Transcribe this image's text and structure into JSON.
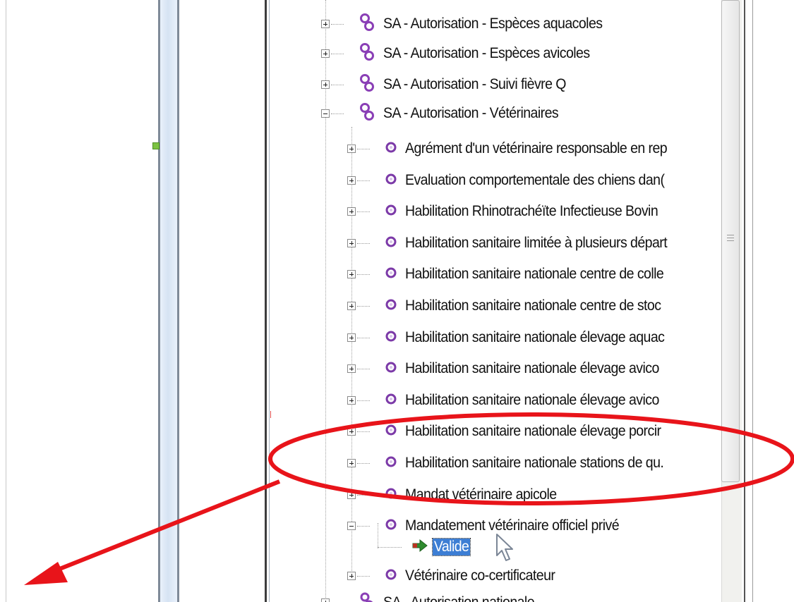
{
  "tree": {
    "groups": [
      {
        "label": "SA - Autorisation - Espèces aquacoles",
        "expanded": false
      },
      {
        "label": "SA - Autorisation - Espèces avicoles",
        "expanded": false
      },
      {
        "label": "SA - Autorisation - Suivi fièvre Q",
        "expanded": false
      },
      {
        "label": "SA - Autorisation - Vétérinaires",
        "expanded": true
      }
    ],
    "children": [
      {
        "label": "Agrément d'un vétérinaire responsable en rep"
      },
      {
        "label": "Evaluation comportementale des chiens dan("
      },
      {
        "label": "Habilitation Rhinotrachéïte Infectieuse Bovin"
      },
      {
        "label": "Habilitation sanitaire limitée à plusieurs départ"
      },
      {
        "label": "Habilitation sanitaire nationale centre de colle"
      },
      {
        "label": "Habilitation sanitaire nationale centre de stoc"
      },
      {
        "label": "Habilitation sanitaire nationale élevage aquac"
      },
      {
        "label": "Habilitation sanitaire nationale élevage avico"
      },
      {
        "label": "Habilitation sanitaire nationale élevage avico"
      },
      {
        "label": "Habilitation sanitaire nationale élevage porcir"
      },
      {
        "label": "Habilitation sanitaire nationale stations de qu."
      },
      {
        "label": "Mandat vétérinaire apicole"
      },
      {
        "label": "Mandatement vétérinaire officiel privé"
      }
    ],
    "state_item": {
      "label": "Valide",
      "selected": true
    },
    "after_children": [
      {
        "label": "Vétérinaire co-certificateur"
      }
    ],
    "last_group": {
      "label": "SA - Autorisation nationale"
    }
  },
  "colors": {
    "annotation": "#e8141a",
    "selection": "#3d7ed4",
    "group_icon": "#8a3fb6",
    "leaf_icon": "#7c3aa8",
    "state_arrow": "#2e8b2e"
  },
  "icons": {
    "group": "linked-circles-icon",
    "leaf": "ring-icon",
    "state": "green-arrow-icon",
    "cursor": "mouse-pointer-icon"
  }
}
